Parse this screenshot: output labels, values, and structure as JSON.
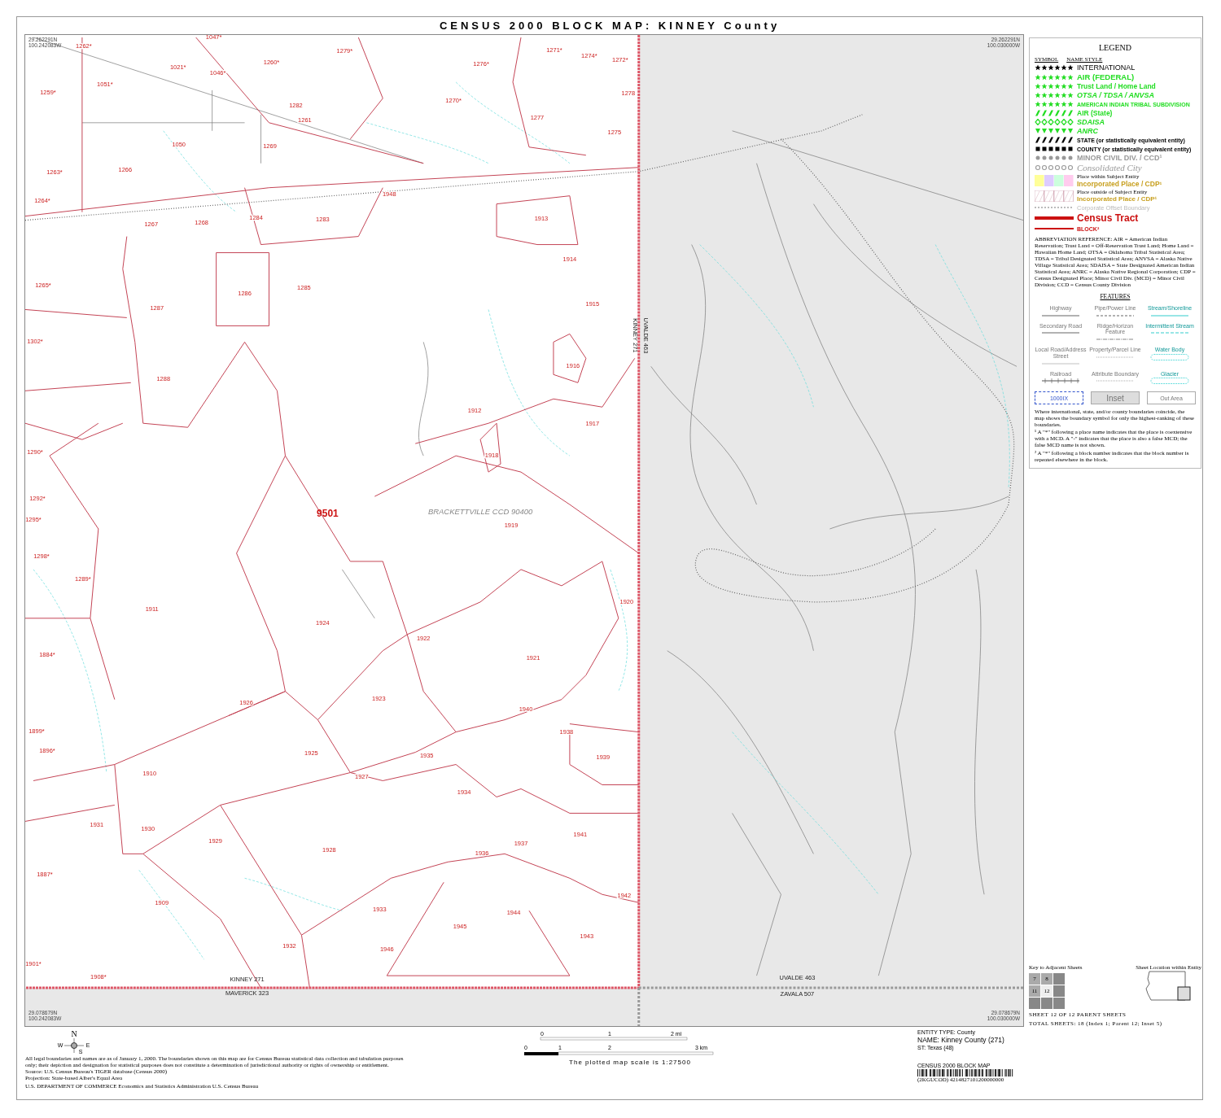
{
  "title": "CENSUS 2000 BLOCK MAP: KINNEY County",
  "map": {
    "corner_labels": [
      [
        "29.262291N",
        "100.242083W"
      ],
      [
        "29.262291N",
        "100.030000W"
      ],
      [
        "29.078679N",
        "100.242083W"
      ],
      [
        "29.078679N",
        "100.030000W"
      ]
    ],
    "tract_label": "9501",
    "ccd_label": "BRACKETTVILLE CCD 90400",
    "block_labels": [
      "1262*",
      "1047*",
      "1279*",
      "1271*",
      "1274*",
      "1272*",
      "1021*",
      "1260*",
      "1276*",
      "1046*",
      "1051*",
      "1259*",
      "1270*",
      "1278",
      "1282",
      "1261",
      "1277",
      "1050",
      "1269",
      "1275",
      "1263*",
      "1266",
      "1264*",
      "1948",
      "1267",
      "1268",
      "1284",
      "1283",
      "1913",
      "1914",
      "1265*",
      "1286",
      "1285",
      "1915",
      "1287",
      "1302*",
      "1916",
      "1288",
      "1912",
      "1917",
      "1918",
      "1919",
      "1290*",
      "1292*",
      "1295*",
      "1298*",
      "1289*",
      "1911",
      "1920",
      "1924",
      "1922",
      "1921",
      "1884*",
      "1926",
      "1923",
      "1940",
      "1938",
      "1899*",
      "1896*",
      "1925",
      "1935",
      "1939",
      "1910",
      "1927",
      "1934",
      "1941",
      "1931",
      "1930",
      "1929",
      "1928",
      "1937",
      "1936",
      "1887*",
      "1909",
      "1942",
      "1933",
      "1944",
      "1945",
      "1943",
      "1932",
      "1946",
      "1901*",
      "1908*"
    ],
    "boundary_labels": [
      "KINNEY 271",
      "UVALDE 463",
      "MAVERICK 323",
      "ZAVALA 507",
      "UVALDE 463",
      "KINNEY 271"
    ]
  },
  "legend": {
    "title": "LEGEND",
    "symbol_heading": "SYMBOL",
    "name_heading": "NAME STYLE",
    "items": [
      {
        "kind": "star",
        "label": "INTERNATIONAL",
        "color": "#000000"
      },
      {
        "kind": "star",
        "label": "AIR (FEDERAL)",
        "color": "#22dd22"
      },
      {
        "kind": "star",
        "label": "Trust Land / Home Land",
        "color": "#22dd22"
      },
      {
        "kind": "star",
        "label": "OTSA / TDSA / ANVSA",
        "color": "#22dd22"
      },
      {
        "kind": "star",
        "label": "AMERICAN INDIAN TRIBAL SUBDIVISION",
        "color": "#22dd22"
      },
      {
        "kind": "hash",
        "label": "AIR (State)",
        "color": "#22dd22"
      },
      {
        "kind": "diamond",
        "label": "SDAISA",
        "color": "#22dd22"
      },
      {
        "kind": "triangle",
        "label": "ANRC",
        "color": "#22dd22"
      },
      {
        "kind": "hash",
        "label": "STATE (or statistically equivalent entity)",
        "color": "#000000"
      },
      {
        "kind": "square",
        "label": "COUNTY (or statistically equivalent entity)",
        "color": "#000000"
      },
      {
        "kind": "dot",
        "label": "MINOR CIVIL DIV. / CCD¹",
        "color": "#999999"
      },
      {
        "kind": "circle",
        "label": "Consolidated City",
        "color": "#999999"
      },
      {
        "kind": "fill",
        "label": "Incorporated Place / CDP¹",
        "note": "Place within Subject Entity",
        "color": "#c8a020"
      },
      {
        "kind": "hatch",
        "label": "Incorporated Place / CDP¹",
        "note": "Place outside of Subject Entity",
        "color": "#c8a020"
      },
      {
        "kind": "dotted",
        "label": "Corporate Offset Boundary",
        "color": "#bbbbbb"
      },
      {
        "kind": "tract",
        "label": "Census Tract",
        "color": "#cc1111"
      },
      {
        "kind": "block",
        "label": "BLOCK²",
        "color": "#cc1111"
      }
    ],
    "abbreviations": "ABBREVIATION REFERENCE: AIR = American Indian Reservation; Trust Land = Off-Reservation Trust Land; Home Land = Hawaiian Home Land; OTSA = Oklahoma Tribal Statistical Area; TDSA = Tribal Designated Statistical Area; ANVSA = Alaska Native Village Statistical Area; SDAISA = State Designated American Indian Statistical Area; ANRC = Alaska Native Regional Corporation; CDP = Census Designated Place; Minor Civil Div. (MCD) = Minor Civil Division; CCD = Census County Division",
    "features_title": "FEATURES",
    "features": [
      {
        "kind": "road",
        "label": "Highway"
      },
      {
        "kind": "pipe",
        "label": "Pipe/Power Line"
      },
      {
        "kind": "stream",
        "label": "Stream/Shoreline"
      },
      {
        "kind": "road",
        "label": "Secondary Road"
      },
      {
        "kind": "ridge",
        "label": "Ridge/Horizon Feature"
      },
      {
        "kind": "intermittent",
        "label": "Intermittent Stream"
      },
      {
        "kind": "local",
        "label": "Local Road/Address Street"
      },
      {
        "kind": "property",
        "label": "Property/Parcel Line"
      },
      {
        "kind": "water",
        "label": "Water Body"
      },
      {
        "kind": "rail",
        "label": "Railroad"
      },
      {
        "kind": "property",
        "label": "Attribute Boundary"
      },
      {
        "kind": "water",
        "label": "Glacier"
      }
    ],
    "boxes": [
      {
        "kind": "dashed",
        "label": "1000IX"
      },
      {
        "kind": "inset",
        "label": "Inset"
      },
      {
        "kind": "out",
        "label": "Out Area"
      }
    ],
    "notes": [
      "Where international, state, and/or county boundaries coincide, the map shows the boundary symbol for only the highest-ranking of these boundaries.",
      "¹ A \"*\" following a place name indicates that the place is coextensive with a MCD. A \"-\" indicates that the place is also a false MCD; the false MCD name is not shown.",
      "² A \"*\" following a block number indicates that the block number is repeated elsewhere in the block."
    ]
  },
  "key_to_adjacent_sheets": {
    "title": "Key to Adjacent Sheets",
    "cells": [
      {
        "label": "7",
        "selected": false
      },
      {
        "label": "8",
        "selected": false
      },
      {
        "selected": false
      },
      {
        "label": "11",
        "selected": false
      },
      {
        "label": "12",
        "selected": true
      },
      {
        "selected": false
      },
      {
        "selected": false
      },
      {
        "selected": false
      },
      {
        "selected": false
      }
    ]
  },
  "sheet_location": {
    "title": "Sheet Location within Entity"
  },
  "sheet_info": [
    "SHEET 12 OF 12 PARENT SHEETS",
    "TOTAL SHEETS: 18 (Index 1; Parent 12; Inset 5)"
  ],
  "compass": [
    "N",
    "W",
    "E",
    "S"
  ],
  "scale": {
    "mile_ticks": [
      "0",
      "1",
      "2 mi"
    ],
    "km_ticks": [
      "0",
      "1",
      "2",
      "3 km"
    ],
    "caption": "The plotted map scale is 1:27500"
  },
  "footer_notes": [
    "All legal boundaries and names are as of January 1, 2000. The boundaries shown on this map are for Census Bureau statistical data collection and tabulation purposes only; their depiction and designation for statistical purposes does not constitute a determination of jurisdictional authority or rights of ownership or entitlement.",
    "Source: U.S. Census Bureau's TIGER database (Census 2000)",
    "Projection: State-based Alber's Equal Area"
  ],
  "agency": "U.S. DEPARTMENT OF COMMERCE Economics and Statistics Administration U.S. Census Bureau",
  "entity": {
    "type": "ENTITY TYPE: County",
    "name": "NAME: Kinney County (271)",
    "state": "ST: Texas (48)"
  },
  "barcode": {
    "title": "CENSUS 2000 BLOCK MAP",
    "code": "(2KGUCOD) 4214827101200000000"
  }
}
